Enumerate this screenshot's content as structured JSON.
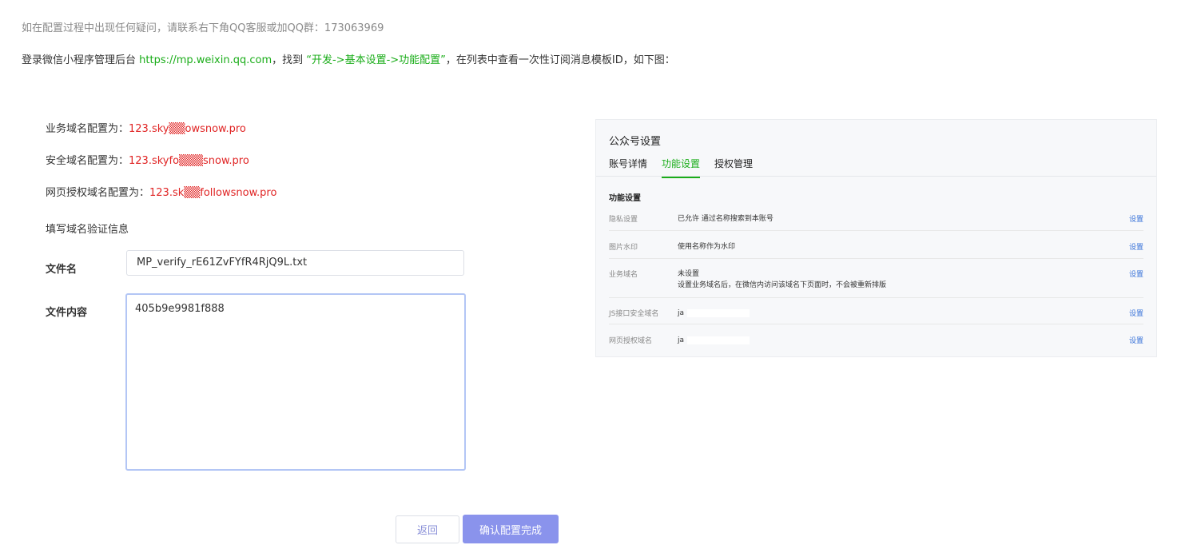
{
  "hint": "如在配置过程中出现任何疑问，请联系右下角QQ客服或加QQ群：173063969",
  "intro": {
    "prefix": "登录微信小程序管理后台 ",
    "link": "https://mp.weixin.qq.com",
    "middle": "，找到 ",
    "path": "“开发->基本设置->功能配置”",
    "suffix": "，在列表中查看一次性订阅消息模板ID，如下图："
  },
  "domains": [
    {
      "label": "业务域名配置为：",
      "value": "123.sky▒▒owsnow.pro"
    },
    {
      "label": "安全域名配置为：",
      "value": "123.skyfo▒▒▒snow.pro"
    },
    {
      "label": "网页授权域名配置为：",
      "value": "123.sk▒▒followsnow.pro"
    }
  ],
  "section_title": "填写域名验证信息",
  "form": {
    "file_name_label": "文件名",
    "file_name_value": "MP_verify_rE61ZvFYfR4RjQ9L.txt",
    "file_content_label": "文件内容",
    "file_content_value": "405b9e9981f888"
  },
  "buttons": {
    "back": "返回",
    "confirm": "确认配置完成"
  },
  "panel": {
    "title": "公众号设置",
    "tabs": [
      "账号详情",
      "功能设置",
      "授权管理"
    ],
    "active_tab": "功能设置",
    "subtitle": "功能设置",
    "rows": [
      {
        "key": "隐私设置",
        "value": "已允许 通过名称搜索到本账号",
        "value2": "",
        "action": "设置"
      },
      {
        "key": "图片水印",
        "value": "使用名称作为水印",
        "value2": "",
        "action": "设置"
      },
      {
        "key": "业务域名",
        "value": "未设置",
        "value2": "设置业务域名后，在微信内访问该域名下页面时，不会被重新排版",
        "action": "设置"
      },
      {
        "key": "JS接口安全域名",
        "value": "ja",
        "value2": "",
        "action": "设置"
      },
      {
        "key": "网页授权域名",
        "value": "ja",
        "value2": "",
        "action": "设置"
      }
    ]
  },
  "colors": {
    "link_green": "#1aad19",
    "domain_red": "#e02424",
    "confirm_bg": "#8a93ec",
    "focus_border": "#b3c6f5"
  }
}
